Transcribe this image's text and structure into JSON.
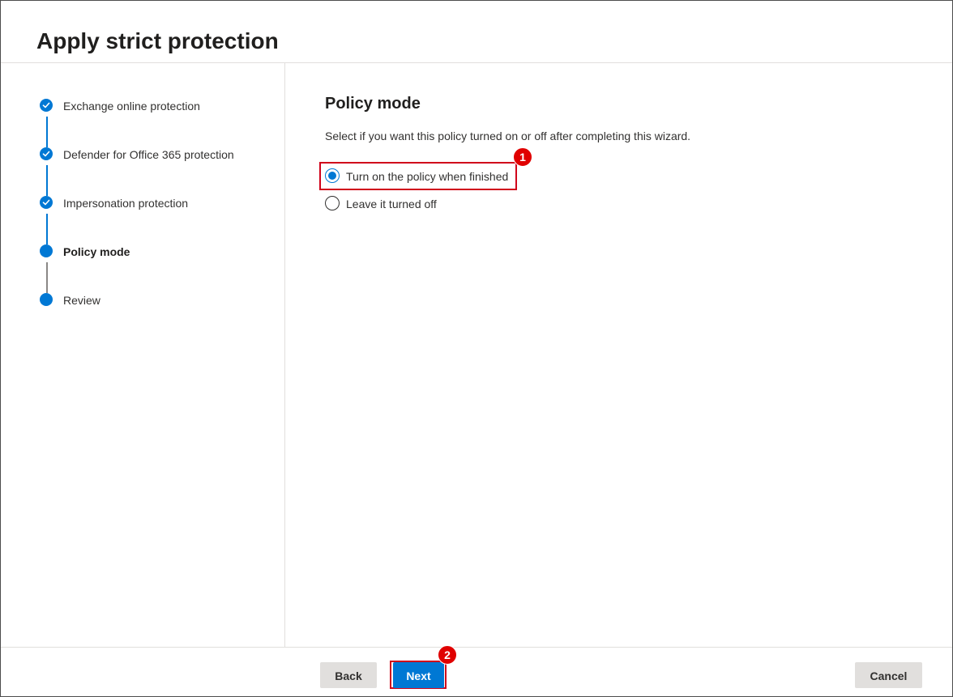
{
  "wizard": {
    "title": "Apply strict protection"
  },
  "steps": [
    {
      "label": "Exchange online protection",
      "status": "completed"
    },
    {
      "label": "Defender for Office 365 protection",
      "status": "completed"
    },
    {
      "label": "Impersonation protection",
      "status": "completed"
    },
    {
      "label": "Policy mode",
      "status": "current"
    },
    {
      "label": "Review",
      "status": "upcoming"
    }
  ],
  "content": {
    "heading": "Policy mode",
    "description": "Select if you want this policy turned on or off after completing this wizard.",
    "options": [
      {
        "label": "Turn on the policy when finished",
        "selected": true
      },
      {
        "label": "Leave it turned off",
        "selected": false
      }
    ]
  },
  "callouts": {
    "first": "1",
    "second": "2"
  },
  "footer": {
    "back_label": "Back",
    "next_label": "Next",
    "cancel_label": "Cancel"
  },
  "colors": {
    "accent": "#0078d4",
    "highlight": "#d0021b",
    "callout": "#e00000"
  },
  "icons": {
    "completed_step": "checkmark-icon",
    "current_step": "dot-icon"
  }
}
